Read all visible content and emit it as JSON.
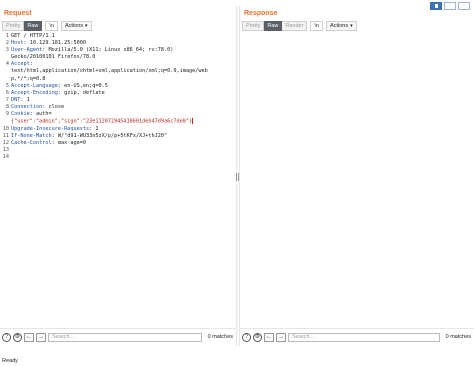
{
  "request": {
    "title": "Request",
    "tabs": {
      "pretty": "Pretty",
      "raw": "Raw",
      "newline": "\\n",
      "actions": "Actions"
    },
    "lines": [
      {
        "n": "1",
        "text": "GET / HTTP/1.1"
      },
      {
        "n": "2",
        "name": "Host",
        "value": "10.129.181.25:5000"
      },
      {
        "n": "3",
        "name": "User-Agent",
        "value": "Mozilla/5.0 (X11; Linux x86_64; rv:78.0)"
      },
      {
        "n": "",
        "text": "Gecko/20100101 Firefox/78.0"
      },
      {
        "n": "4",
        "name": "Accept",
        "value": ""
      },
      {
        "n": "",
        "text": "text/html,application/xhtml+xml,application/xml;q=0.9,image/web"
      },
      {
        "n": "",
        "text": "p,*/*;q=0.8"
      },
      {
        "n": "5",
        "name": "Accept-Language",
        "value": "en-US,en;q=0.5"
      },
      {
        "n": "6",
        "name": "Accept-Encoding",
        "value": "gzip, deflate"
      },
      {
        "n": "7",
        "name": "DNT",
        "value": "1"
      },
      {
        "n": "8",
        "name": "Connection",
        "value": "close"
      },
      {
        "n": "9",
        "name": "Cookie",
        "value": "auth="
      },
      {
        "n": "",
        "cookie": "{\"user\":\"admin\",\"sign\":\"23e112072945418601deb47d9a6c7de8\"}"
      },
      {
        "n": "10",
        "name": "Upgrade-Insecure-Requests",
        "value": "1"
      },
      {
        "n": "11",
        "name": "If-None-Match",
        "value": "W/\"d91-WU33n5zX/p/p+5tKFx/XJ+thJ20\""
      },
      {
        "n": "12",
        "name": "Cache-Control",
        "value": "max-age=0"
      },
      {
        "n": "13",
        "text": ""
      },
      {
        "n": "14",
        "text": ""
      }
    ],
    "search": {
      "placeholder": "Search...",
      "matches": "0 matches"
    }
  },
  "response": {
    "title": "Response",
    "tabs": {
      "pretty": "Pretty",
      "raw": "Raw",
      "render": "Render",
      "newline": "\\n",
      "actions": "Actions"
    },
    "search": {
      "placeholder": "Search...",
      "matches": "0 matches"
    }
  },
  "icons": {
    "help": "question-icon",
    "settings": "gear-icon",
    "prev": "arrow-left-icon",
    "next": "arrow-right-icon"
  },
  "status": "Ready",
  "colors": {
    "accent": "#e8712a",
    "header_name": "#1f4fa3",
    "cookie": "#b5261e",
    "active_tab": "#5b5f66"
  }
}
